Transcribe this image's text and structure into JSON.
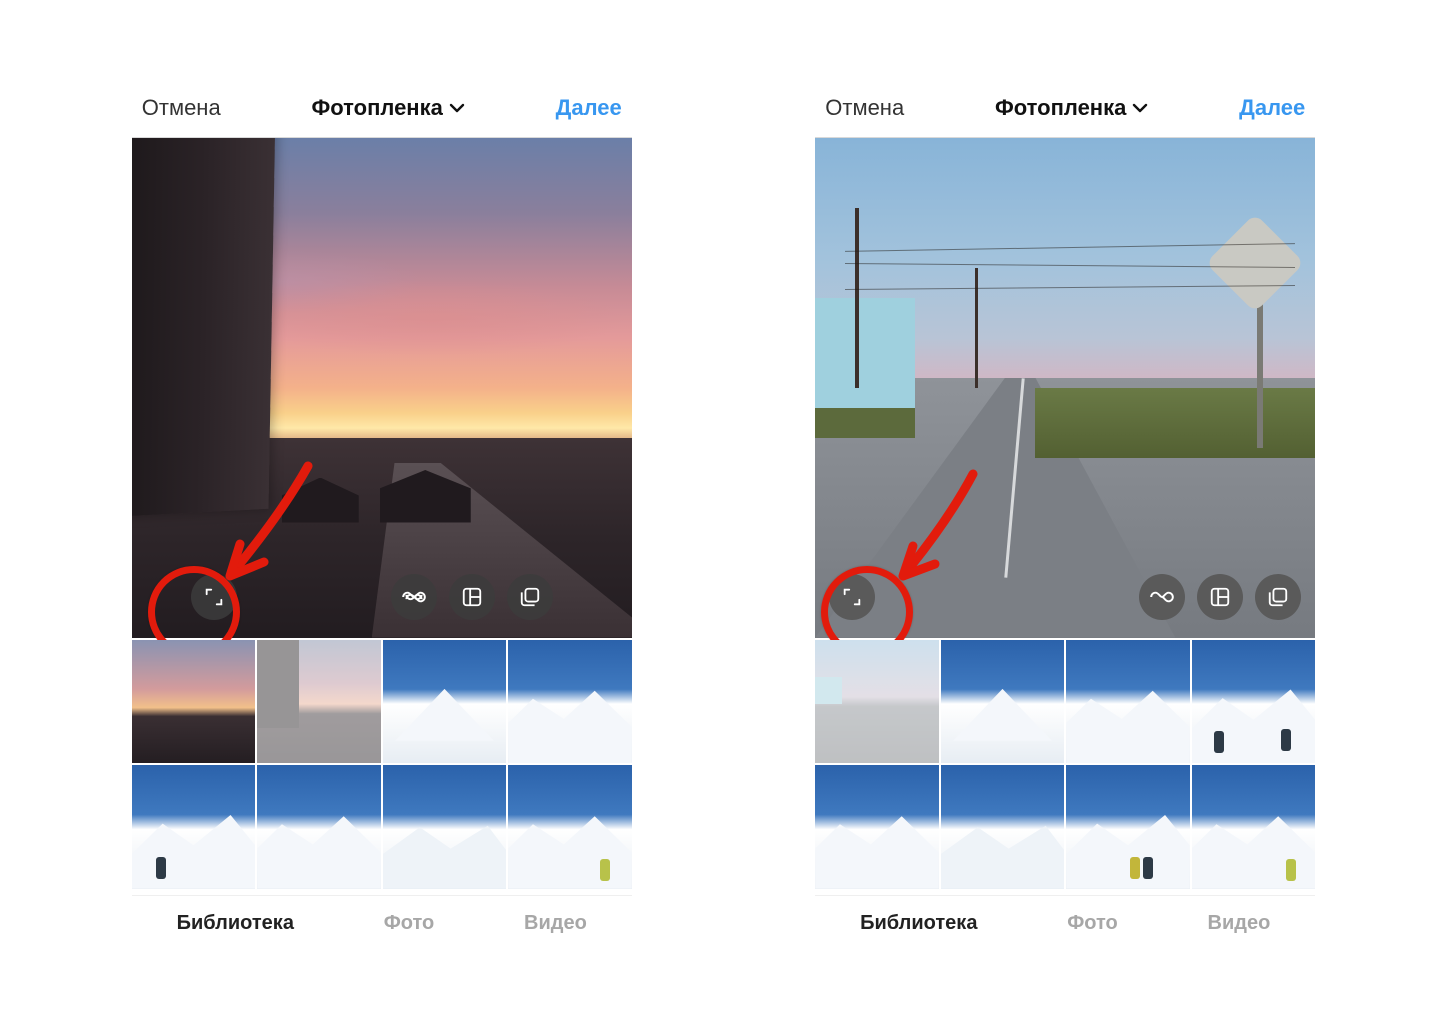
{
  "navbar": {
    "cancel": "Отмена",
    "title": "Фотопленка",
    "next": "Далее"
  },
  "tools": {
    "expand": "expand-crop-icon",
    "boomerang": "infinity-icon",
    "layout": "layout-icon",
    "multi": "multi-select-icon"
  },
  "tabs": {
    "library": "Библиотека",
    "photo": "Фото",
    "video": "Видео"
  },
  "annotation": {
    "color": "#e21b0c"
  },
  "screens": [
    {
      "id": "left",
      "preview": "sunset-portrait",
      "preview_mode": "portrait",
      "thumbs": [
        {
          "kind": "sunset",
          "selected": false
        },
        {
          "kind": "sunset-building",
          "selected": true
        },
        {
          "kind": "mountain-peak",
          "selected": false
        },
        {
          "kind": "mountain-slope",
          "selected": false
        },
        {
          "kind": "mountain-ridge-a",
          "selected": false
        },
        {
          "kind": "mountain-ridge-b",
          "selected": false
        },
        {
          "kind": "mountain-ridge-c",
          "selected": false
        },
        {
          "kind": "mountain-person",
          "selected": false
        }
      ]
    },
    {
      "id": "right",
      "preview": "coastal-road-landscape",
      "preview_mode": "landscape",
      "thumbs": [
        {
          "kind": "coast",
          "selected": true
        },
        {
          "kind": "mountain-peak",
          "selected": false
        },
        {
          "kind": "mountain-slope",
          "selected": false
        },
        {
          "kind": "mountain-people",
          "selected": false
        },
        {
          "kind": "mountain-ridge-a",
          "selected": false
        },
        {
          "kind": "mountain-ridge-b",
          "selected": false
        },
        {
          "kind": "mountain-people-b",
          "selected": false
        },
        {
          "kind": "mountain-person",
          "selected": false
        }
      ]
    }
  ]
}
